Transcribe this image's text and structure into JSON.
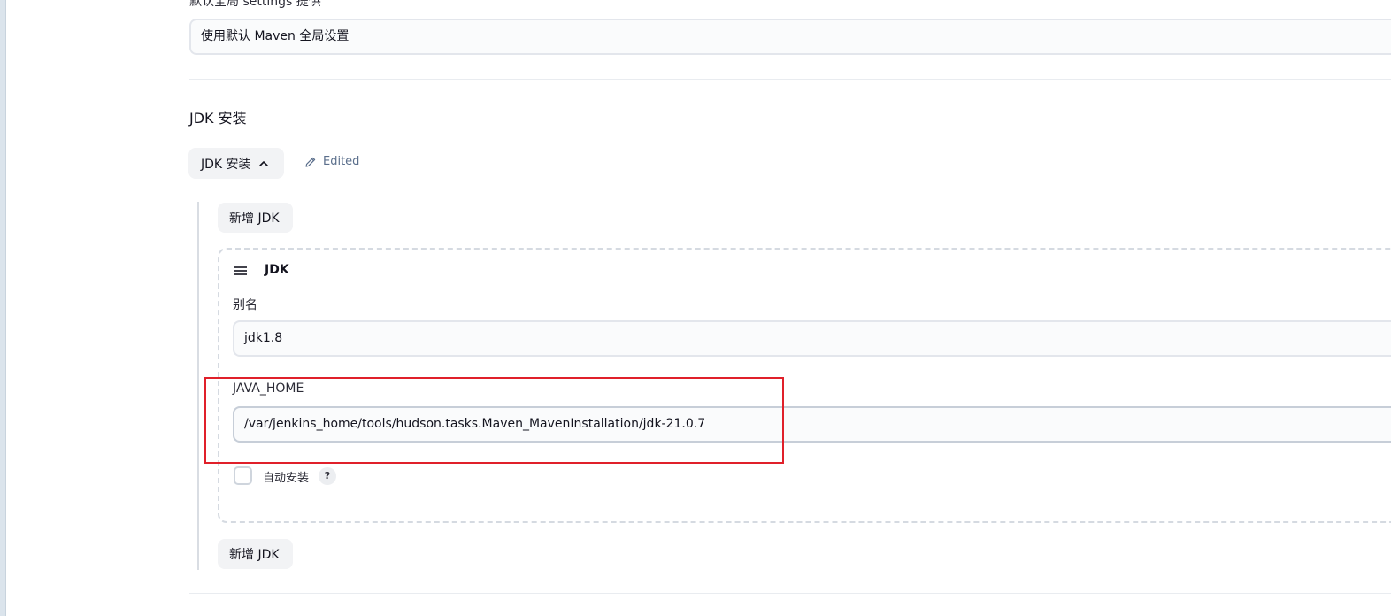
{
  "global_settings": {
    "label": "默认全局 settings 提供",
    "value": "使用默认 Maven 全局设置"
  },
  "jdk_section": {
    "title": "JDK 安装",
    "toggle_label": "JDK 安装",
    "edited_label": "Edited",
    "add_button_top": "新增 JDK",
    "add_button_bottom": "新增 JDK",
    "card": {
      "title": "JDK",
      "alias_label": "别名",
      "alias_value": "jdk1.8",
      "java_home_label": "JAVA_HOME",
      "java_home_value": "/var/jenkins_home/tools/hudson.tasks.Maven_MavenInstallation/jdk-21.0.7",
      "auto_install_label": "自动安装",
      "auto_install_checked": false,
      "help_label": "?"
    }
  },
  "colors": {
    "highlight": "#e0202a",
    "edited": "#5b6f8c"
  },
  "icons": {
    "toggle": "chevron-up-icon",
    "edited": "pencil-icon",
    "drag": "drag-handle-icon"
  }
}
